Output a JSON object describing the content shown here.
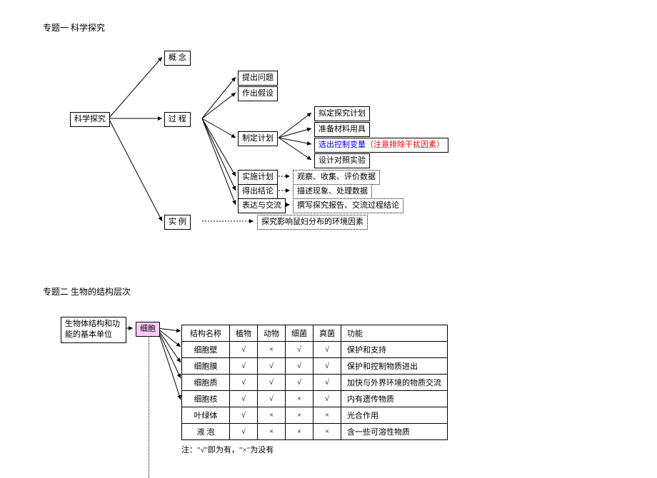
{
  "title1": "专题一   科学探究",
  "title2": "专题二  生物的结构层次",
  "d1": {
    "root": "科学探究",
    "b1": "概    念",
    "b2": "过    程",
    "b3": "实    例",
    "p1": "提出问题",
    "p2": "作出假设",
    "p3": "制定计划",
    "p4": "实施计划",
    "p5": "得出结论",
    "p6": "表达与交流",
    "c1": "拟定探究计划",
    "c2": "准备材料用具",
    "c3a": "选出控制变量",
    "c3b": "（注意排除干扰因素）",
    "c4": "设计对照实验",
    "r4": "观察、收集、评价数据",
    "r5": "描述现象、处理数据",
    "r6": "撰写探究报告、交流过程结论",
    "ex": "探究影响鼠妇分布的环境因素"
  },
  "d2": {
    "left": "生物体结构和功能的基本单位",
    "cell": "细胞",
    "note": "注：\"√\"即为有，\"×\"为没有",
    "headers": [
      "结构名称",
      "植物",
      "动物",
      "细菌",
      "真菌",
      "功能"
    ],
    "rows": [
      [
        "细胞壁",
        "√",
        "×",
        "√",
        "√",
        "保护和支持"
      ],
      [
        "细胞膜",
        "√",
        "√",
        "√",
        "√",
        "保护和控制物质进出"
      ],
      [
        "细胞质",
        "√",
        "√",
        "√",
        "√",
        "加快与外界环境的物质交流"
      ],
      [
        "细胞核",
        "√",
        "√",
        "×",
        "√",
        "内有遗传物质"
      ],
      [
        "叶绿体",
        "√",
        "×",
        "×",
        "×",
        "光合作用"
      ],
      [
        "液  泡",
        "√",
        "×",
        "×",
        "×",
        "含一些可溶性物质"
      ]
    ]
  }
}
